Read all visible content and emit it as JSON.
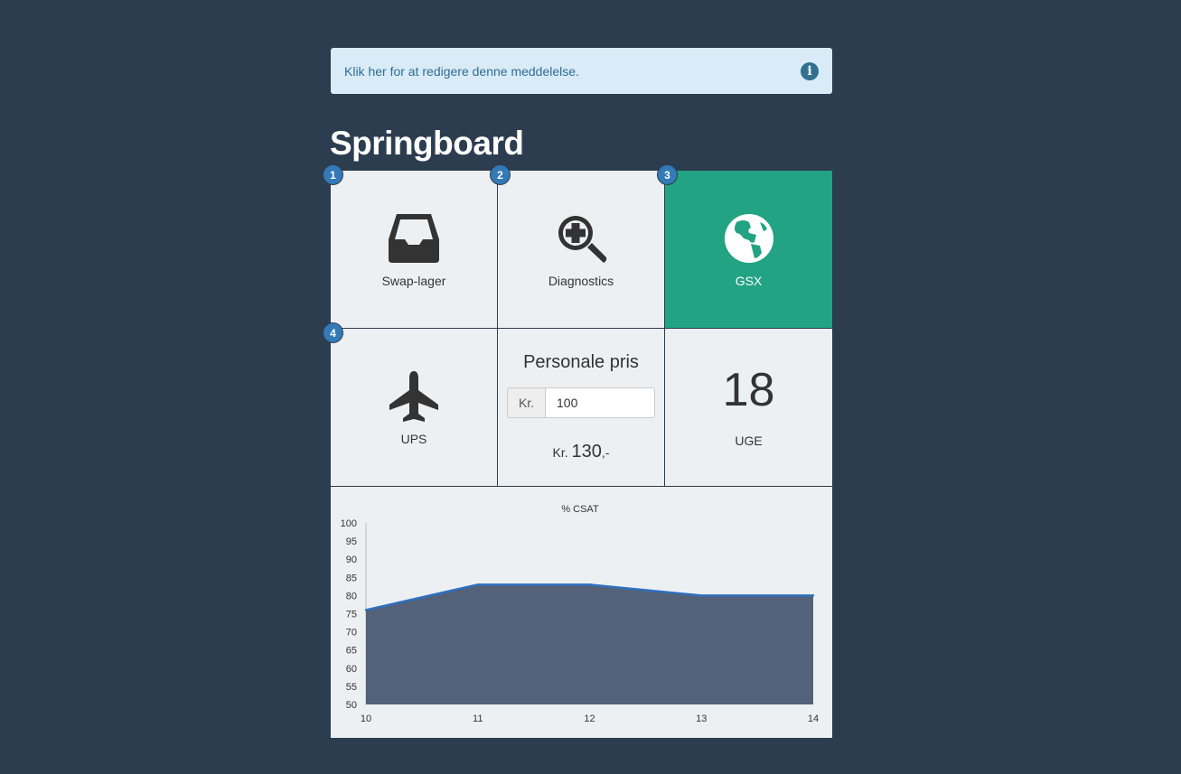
{
  "alert": {
    "text": "Klik her for at redigere denne meddelelse.",
    "icon": "info-icon"
  },
  "page": {
    "title": "Springboard"
  },
  "tiles": [
    {
      "badge": "1",
      "label": "Swap-lager",
      "icon": "inbox-icon"
    },
    {
      "badge": "2",
      "label": "Diagnostics",
      "icon": "zoom-in-icon"
    },
    {
      "badge": "3",
      "label": "GSX",
      "icon": "globe-icon"
    },
    {
      "badge": "4",
      "label": "UPS",
      "icon": "plane-icon"
    }
  ],
  "price": {
    "title": "Personale pris",
    "currency": "Kr.",
    "input_value": "100",
    "result_prefix": "Kr.",
    "result_value": "130",
    "result_suffix": ",-"
  },
  "week": {
    "number": "18",
    "label": "UGE"
  },
  "colors": {
    "background": "#2d3d50",
    "active_tile": "#22a383",
    "badge": "#337ab7",
    "line": "#2f6fbf",
    "area": "#536278"
  },
  "chart_data": {
    "type": "area",
    "title": "% CSAT",
    "x": [
      10,
      11,
      12,
      13,
      14
    ],
    "series": [
      {
        "values": [
          76,
          83,
          83,
          80,
          80
        ]
      }
    ],
    "ylim": [
      50,
      100
    ],
    "yticks": [
      100,
      95,
      90,
      85,
      80,
      75,
      70,
      65,
      60,
      55,
      50
    ],
    "xticks": [
      10,
      11,
      12,
      13,
      14
    ],
    "grid": false
  }
}
